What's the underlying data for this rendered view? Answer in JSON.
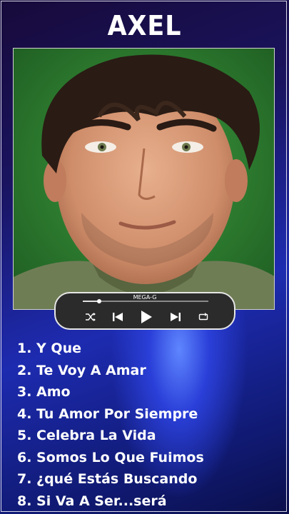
{
  "header": {
    "title": "AXEL"
  },
  "player": {
    "label": "MEGA-G",
    "progress_fraction": 0.13,
    "controls": [
      "shuffle-icon",
      "previous-icon",
      "play-icon",
      "next-icon",
      "repeat-icon"
    ]
  },
  "tracks": [
    "1. Y Que",
    "2. Te Voy A Amar",
    "3. Amo",
    "4. Tu Amor Por Siempre",
    "5. Celebra La Vida",
    "6. Somos Lo Que Fuimos",
    "7. ¿qué Estás Buscando",
    "8. Si Va A Ser...será"
  ],
  "colors": {
    "background_dark": "#170a3a",
    "background_accent": "#5f86ff",
    "cover_backdrop": "#2f7d33",
    "player_bg": "#2b2b2b",
    "text": "#ffffff"
  }
}
